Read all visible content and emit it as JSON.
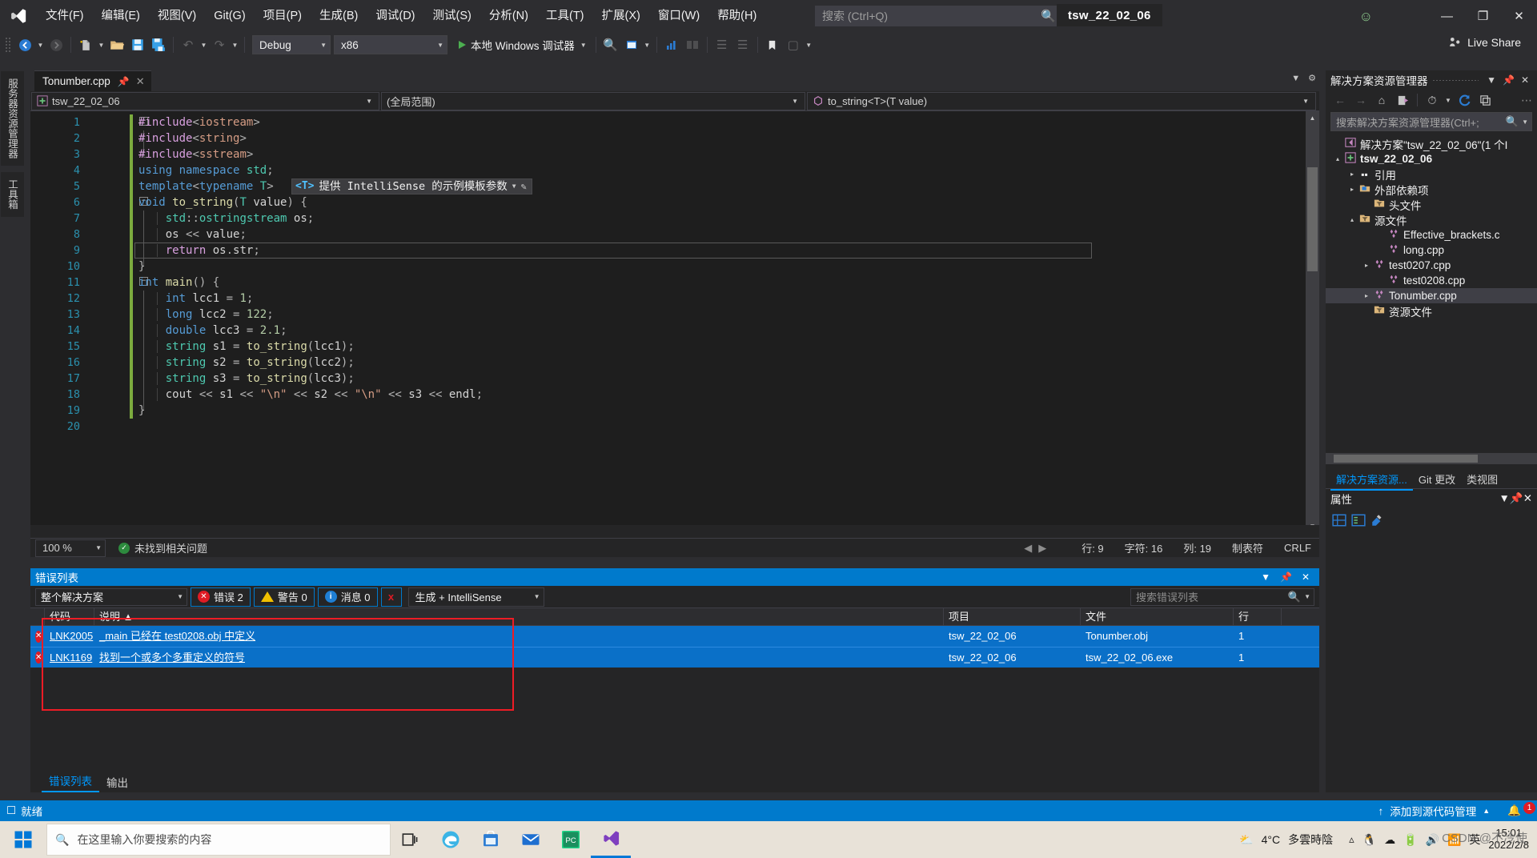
{
  "titlebar": {
    "logo": "vs-logo",
    "menu": [
      "文件(F)",
      "编辑(E)",
      "视图(V)",
      "Git(G)",
      "项目(P)",
      "生成(B)",
      "调试(D)",
      "测试(S)",
      "分析(N)",
      "工具(T)",
      "扩展(X)",
      "窗口(W)",
      "帮助(H)"
    ],
    "search_placeholder": "搜索 (Ctrl+Q)",
    "project_pill": "tsw_22_02_06",
    "feedback_icon": "feedback-smiley-icon",
    "window_buttons": {
      "minimize": "—",
      "maximize": "❐",
      "close": "✕"
    }
  },
  "toolbar": {
    "back": "◀",
    "forward": "▶",
    "new_item": "new-item-icon",
    "open": "open-folder-icon",
    "save": "save-icon",
    "save_all": "save-all-icon",
    "undo": "↺",
    "redo": "↻",
    "config": "Debug",
    "platform": "x86",
    "run_label": "本地 Windows 调试器",
    "live_share": "Live Share"
  },
  "vtabs": [
    "服务器资源管理器",
    "工具箱"
  ],
  "editor": {
    "tab_title": "Tonumber.cpp",
    "pin_icon": "pin-icon",
    "close_icon": "close-icon",
    "nav_project": "tsw_22_02_06",
    "nav_scope": "(全局范围)",
    "nav_member": "to_string<T>(T value)",
    "tooltip": {
      "token": "<T>",
      "text": "提供 IntelliSense 的示例模板参数",
      "pencil": "pencil-icon"
    },
    "lines": [
      {
        "n": 1,
        "fold": "−",
        "text": "#include<iostream>"
      },
      {
        "n": 2,
        "fold": "",
        "text": "#include<string>"
      },
      {
        "n": 3,
        "fold": "",
        "text": "#include<sstream>"
      },
      {
        "n": 4,
        "fold": "",
        "text": "using namespace std;"
      },
      {
        "n": 5,
        "fold": "",
        "text": "template<typename T>"
      },
      {
        "n": 6,
        "fold": "−",
        "text": "void to_string(T value) {"
      },
      {
        "n": 7,
        "fold": "",
        "text": "    std::ostringstream os;"
      },
      {
        "n": 8,
        "fold": "",
        "text": "    os << value;"
      },
      {
        "n": 9,
        "fold": "",
        "text": "    return os.str;"
      },
      {
        "n": 10,
        "fold": "",
        "text": "}"
      },
      {
        "n": 11,
        "fold": "−",
        "text": "int main() {"
      },
      {
        "n": 12,
        "fold": "",
        "text": "    int lcc1 = 1;"
      },
      {
        "n": 13,
        "fold": "",
        "text": "    long lcc2 = 122;"
      },
      {
        "n": 14,
        "fold": "",
        "text": "    double lcc3 = 2.1;"
      },
      {
        "n": 15,
        "fold": "",
        "text": "    string s1 = to_string(lcc1);"
      },
      {
        "n": 16,
        "fold": "",
        "text": "    string s2 = to_string(lcc2);"
      },
      {
        "n": 17,
        "fold": "",
        "text": "    string s3 = to_string(lcc3);"
      },
      {
        "n": 18,
        "fold": "",
        "text": "    cout << s1 << \"\\n\" << s2 << \"\\n\" << s3 << endl;"
      },
      {
        "n": 19,
        "fold": "",
        "text": "}"
      },
      {
        "n": 20,
        "fold": "",
        "text": ""
      }
    ]
  },
  "edit_status": {
    "zoom": "100 %",
    "issues": "未找到相关问题",
    "row": "行: 9",
    "chars": "字符: 16",
    "col": "列: 19",
    "tabs": "制表符",
    "eol": "CRLF"
  },
  "error_panel": {
    "title": "错误列表",
    "scope": "整个解决方案",
    "errors_label": "错误 2",
    "warnings_label": "警告 0",
    "messages_label": "消息 0",
    "filter_icon": "clear-filter-icon",
    "build_filter": "生成 + IntelliSense",
    "search_placeholder": "搜索错误列表",
    "columns": [
      "",
      "代码",
      "说明 ▲",
      "项目",
      "文件",
      "行"
    ],
    "rows": [
      {
        "code": "LNK2005",
        "desc": "_main 已经在 test0208.obj 中定义",
        "project": "tsw_22_02_06",
        "file": "Tonumber.obj",
        "line": "1"
      },
      {
        "code": "LNK1169",
        "desc": "找到一个或多个多重定义的符号",
        "project": "tsw_22_02_06",
        "file": "tsw_22_02_06.exe",
        "line": "1"
      }
    ],
    "tabs": [
      {
        "label": "错误列表",
        "active": true
      },
      {
        "label": "输出",
        "active": false
      }
    ]
  },
  "solution_explorer": {
    "title": "解决方案资源管理器",
    "search_placeholder": "搜索解决方案资源管理器(Ctrl+;",
    "toolbar": [
      "back-icon",
      "forward-icon",
      "home-icon",
      "sync-with-document-icon",
      "pending-changes-icon",
      "refresh-icon",
      "collapse-all-icon"
    ],
    "tree": [
      {
        "indent": 0,
        "exp": "",
        "icon": "solution-icon",
        "label": "解决方案\"tsw_22_02_06\"(1 个I",
        "bold": false,
        "selected": false
      },
      {
        "indent": 1,
        "exp": "▴",
        "icon": "project-icon",
        "label": "tsw_22_02_06",
        "bold": true,
        "selected": false
      },
      {
        "indent": 2,
        "exp": "▸",
        "icon": "references-icon",
        "label": "引用",
        "bold": false,
        "selected": false
      },
      {
        "indent": 2,
        "exp": "▸",
        "icon": "ext-deps-icon",
        "label": "外部依赖项",
        "bold": false,
        "selected": false
      },
      {
        "indent": 3,
        "exp": "",
        "icon": "filter-folder-icon",
        "label": "头文件",
        "bold": false,
        "selected": false
      },
      {
        "indent": 2,
        "exp": "▴",
        "icon": "filter-folder-icon",
        "label": "源文件",
        "bold": false,
        "selected": false
      },
      {
        "indent": 4,
        "exp": "",
        "icon": "cpp-file-icon",
        "label": "Effective_brackets.c",
        "bold": false,
        "selected": false
      },
      {
        "indent": 4,
        "exp": "",
        "icon": "cpp-file-icon",
        "label": "long.cpp",
        "bold": false,
        "selected": false
      },
      {
        "indent": 3,
        "exp": "▸",
        "icon": "cpp-file-icon",
        "label": "test0207.cpp",
        "bold": false,
        "selected": false
      },
      {
        "indent": 4,
        "exp": "",
        "icon": "cpp-file-icon",
        "label": "test0208.cpp",
        "bold": false,
        "selected": false
      },
      {
        "indent": 3,
        "exp": "▸",
        "icon": "cpp-file-icon",
        "label": "Tonumber.cpp",
        "bold": false,
        "selected": true
      },
      {
        "indent": 3,
        "exp": "",
        "icon": "filter-folder-icon",
        "label": "资源文件",
        "bold": false,
        "selected": false
      }
    ],
    "bottom_tabs": [
      {
        "label": "解决方案资源...",
        "active": true
      },
      {
        "label": "Git 更改",
        "active": false
      },
      {
        "label": "类视图",
        "active": false
      }
    ]
  },
  "properties_pane": {
    "title": "属性",
    "tools": [
      "categorized-icon",
      "alphabetical-icon",
      "properties-icon"
    ]
  },
  "statusbar": {
    "ready": "就绪",
    "source_control": "添加到源代码管理",
    "notification_count": "1"
  },
  "taskbar": {
    "search_placeholder": "在这里输入你要搜索的内容",
    "icons": [
      "task-view-icon",
      "edge-icon",
      "store-icon",
      "mail-icon",
      "pycharm-icon",
      "vs-icon"
    ],
    "weather_temp": "4°C",
    "weather_desc": "多雲時陰",
    "tray": [
      "qq-icon",
      "onedrive-icon",
      "battery-icon",
      "volume-icon",
      "wifi-icon"
    ],
    "ime": "英",
    "time": "15:01",
    "date": "2022/2/8",
    "watermark": "CSDN @不冷使"
  },
  "colors": {
    "accent": "#007acc",
    "error": "#e01b24",
    "selection": "#0a70c8",
    "redbox": "#ee1c25"
  }
}
